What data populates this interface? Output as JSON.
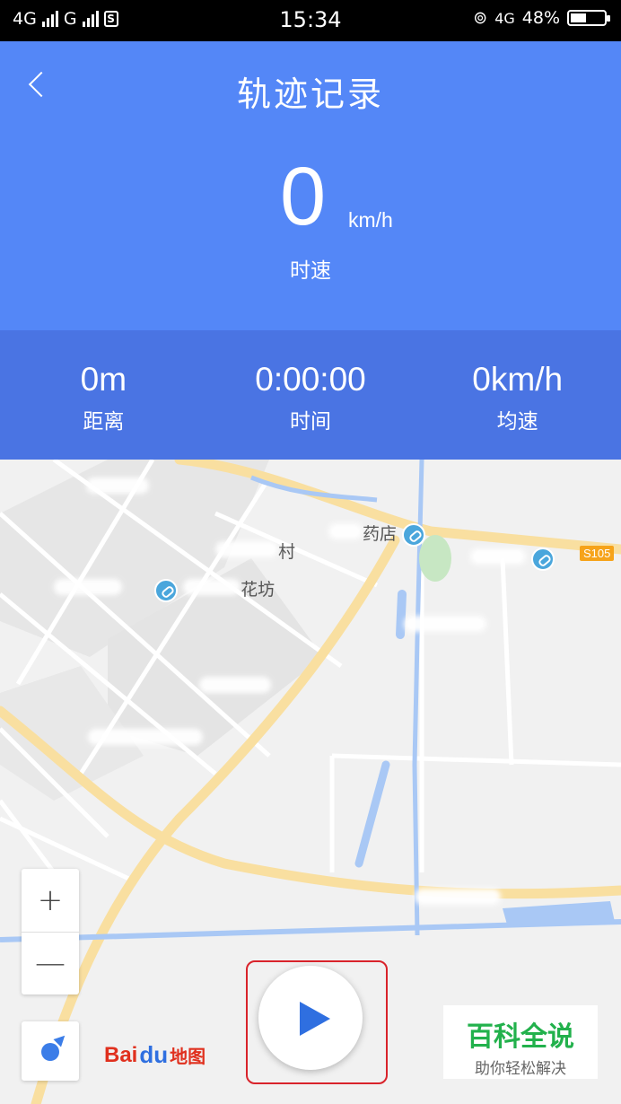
{
  "status_bar": {
    "network_1": "4G",
    "network_2": "G",
    "sim_label": "S",
    "time": "15:34",
    "network_3": "4G",
    "battery_percent": "48%",
    "battery_level": 0.48
  },
  "header": {
    "title": "轨迹记录",
    "speed_value": "0",
    "speed_unit": "km/h",
    "speed_label": "时速"
  },
  "stats": [
    {
      "value": "0m",
      "label": "距离"
    },
    {
      "value": "0:00:00",
      "label": "时间"
    },
    {
      "value": "0km/h",
      "label": "均速"
    }
  ],
  "map": {
    "poi_pharmacy": "药店",
    "poi_village": "村",
    "poi_misc": "花坊",
    "road_badge": "S105",
    "zoom_in": "+",
    "zoom_out": "—",
    "logo_text": "Bai",
    "logo_paw": "du",
    "logo_map": "地图"
  },
  "watermark": {
    "title": "百科全说",
    "subtitle": "助你轻松解决"
  },
  "colors": {
    "header_bg": "#5487f7",
    "stats_bg": "#4a74e3",
    "accent": "#2f6fe0",
    "highlight": "#d9232b"
  }
}
